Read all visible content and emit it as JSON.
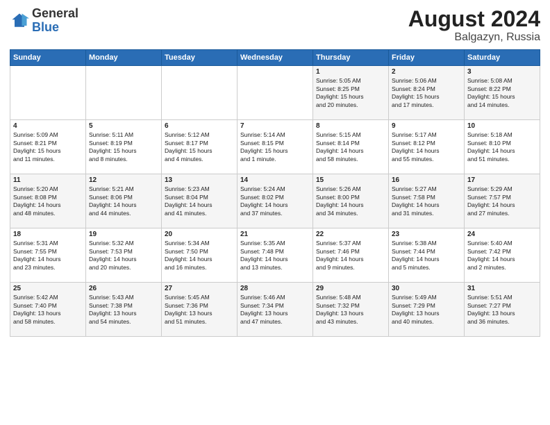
{
  "header": {
    "logo_general": "General",
    "logo_blue": "Blue",
    "month_year": "August 2024",
    "location": "Balgazyn, Russia"
  },
  "days_of_week": [
    "Sunday",
    "Monday",
    "Tuesday",
    "Wednesday",
    "Thursday",
    "Friday",
    "Saturday"
  ],
  "weeks": [
    [
      {
        "day": "",
        "info": ""
      },
      {
        "day": "",
        "info": ""
      },
      {
        "day": "",
        "info": ""
      },
      {
        "day": "",
        "info": ""
      },
      {
        "day": "1",
        "info": "Sunrise: 5:05 AM\nSunset: 8:25 PM\nDaylight: 15 hours\nand 20 minutes."
      },
      {
        "day": "2",
        "info": "Sunrise: 5:06 AM\nSunset: 8:24 PM\nDaylight: 15 hours\nand 17 minutes."
      },
      {
        "day": "3",
        "info": "Sunrise: 5:08 AM\nSunset: 8:22 PM\nDaylight: 15 hours\nand 14 minutes."
      }
    ],
    [
      {
        "day": "4",
        "info": "Sunrise: 5:09 AM\nSunset: 8:21 PM\nDaylight: 15 hours\nand 11 minutes."
      },
      {
        "day": "5",
        "info": "Sunrise: 5:11 AM\nSunset: 8:19 PM\nDaylight: 15 hours\nand 8 minutes."
      },
      {
        "day": "6",
        "info": "Sunrise: 5:12 AM\nSunset: 8:17 PM\nDaylight: 15 hours\nand 4 minutes."
      },
      {
        "day": "7",
        "info": "Sunrise: 5:14 AM\nSunset: 8:15 PM\nDaylight: 15 hours\nand 1 minute."
      },
      {
        "day": "8",
        "info": "Sunrise: 5:15 AM\nSunset: 8:14 PM\nDaylight: 14 hours\nand 58 minutes."
      },
      {
        "day": "9",
        "info": "Sunrise: 5:17 AM\nSunset: 8:12 PM\nDaylight: 14 hours\nand 55 minutes."
      },
      {
        "day": "10",
        "info": "Sunrise: 5:18 AM\nSunset: 8:10 PM\nDaylight: 14 hours\nand 51 minutes."
      }
    ],
    [
      {
        "day": "11",
        "info": "Sunrise: 5:20 AM\nSunset: 8:08 PM\nDaylight: 14 hours\nand 48 minutes."
      },
      {
        "day": "12",
        "info": "Sunrise: 5:21 AM\nSunset: 8:06 PM\nDaylight: 14 hours\nand 44 minutes."
      },
      {
        "day": "13",
        "info": "Sunrise: 5:23 AM\nSunset: 8:04 PM\nDaylight: 14 hours\nand 41 minutes."
      },
      {
        "day": "14",
        "info": "Sunrise: 5:24 AM\nSunset: 8:02 PM\nDaylight: 14 hours\nand 37 minutes."
      },
      {
        "day": "15",
        "info": "Sunrise: 5:26 AM\nSunset: 8:00 PM\nDaylight: 14 hours\nand 34 minutes."
      },
      {
        "day": "16",
        "info": "Sunrise: 5:27 AM\nSunset: 7:58 PM\nDaylight: 14 hours\nand 31 minutes."
      },
      {
        "day": "17",
        "info": "Sunrise: 5:29 AM\nSunset: 7:57 PM\nDaylight: 14 hours\nand 27 minutes."
      }
    ],
    [
      {
        "day": "18",
        "info": "Sunrise: 5:31 AM\nSunset: 7:55 PM\nDaylight: 14 hours\nand 23 minutes."
      },
      {
        "day": "19",
        "info": "Sunrise: 5:32 AM\nSunset: 7:53 PM\nDaylight: 14 hours\nand 20 minutes."
      },
      {
        "day": "20",
        "info": "Sunrise: 5:34 AM\nSunset: 7:50 PM\nDaylight: 14 hours\nand 16 minutes."
      },
      {
        "day": "21",
        "info": "Sunrise: 5:35 AM\nSunset: 7:48 PM\nDaylight: 14 hours\nand 13 minutes."
      },
      {
        "day": "22",
        "info": "Sunrise: 5:37 AM\nSunset: 7:46 PM\nDaylight: 14 hours\nand 9 minutes."
      },
      {
        "day": "23",
        "info": "Sunrise: 5:38 AM\nSunset: 7:44 PM\nDaylight: 14 hours\nand 5 minutes."
      },
      {
        "day": "24",
        "info": "Sunrise: 5:40 AM\nSunset: 7:42 PM\nDaylight: 14 hours\nand 2 minutes."
      }
    ],
    [
      {
        "day": "25",
        "info": "Sunrise: 5:42 AM\nSunset: 7:40 PM\nDaylight: 13 hours\nand 58 minutes."
      },
      {
        "day": "26",
        "info": "Sunrise: 5:43 AM\nSunset: 7:38 PM\nDaylight: 13 hours\nand 54 minutes."
      },
      {
        "day": "27",
        "info": "Sunrise: 5:45 AM\nSunset: 7:36 PM\nDaylight: 13 hours\nand 51 minutes."
      },
      {
        "day": "28",
        "info": "Sunrise: 5:46 AM\nSunset: 7:34 PM\nDaylight: 13 hours\nand 47 minutes."
      },
      {
        "day": "29",
        "info": "Sunrise: 5:48 AM\nSunset: 7:32 PM\nDaylight: 13 hours\nand 43 minutes."
      },
      {
        "day": "30",
        "info": "Sunrise: 5:49 AM\nSunset: 7:29 PM\nDaylight: 13 hours\nand 40 minutes."
      },
      {
        "day": "31",
        "info": "Sunrise: 5:51 AM\nSunset: 7:27 PM\nDaylight: 13 hours\nand 36 minutes."
      }
    ]
  ]
}
